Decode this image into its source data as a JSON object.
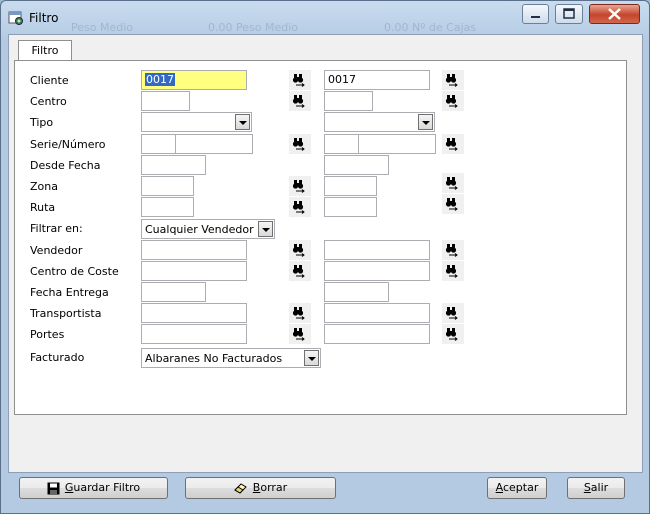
{
  "window": {
    "title": "Filtro",
    "background_hints": [
      "Peso Medio",
      "0.00 Peso Medio",
      "0.00 Nº de Cajas"
    ]
  },
  "tabs": [
    {
      "label": "Filtro",
      "active": true
    }
  ],
  "form": {
    "rows": {
      "cliente": {
        "label": "Cliente",
        "from": "0017",
        "to": "0017"
      },
      "centro": {
        "label": "Centro",
        "from": "",
        "to": ""
      },
      "tipo": {
        "label": "Tipo",
        "from": "",
        "to": ""
      },
      "serie_numero": {
        "label": "Serie/Número",
        "from_serie": "",
        "from_numero": "",
        "to_serie": "",
        "to_numero": ""
      },
      "desde_fecha": {
        "label": "Desde Fecha",
        "from": "",
        "to": ""
      },
      "zona": {
        "label": "Zona",
        "from": "",
        "to": ""
      },
      "ruta": {
        "label": "Ruta",
        "from": "",
        "to": ""
      },
      "filtrar_en": {
        "label": "Filtrar en:",
        "value": "Cualquier Vendedor"
      },
      "vendedor": {
        "label": "Vendedor",
        "from": "",
        "to": ""
      },
      "centro_coste": {
        "label": "Centro de Coste",
        "from": "",
        "to": ""
      },
      "fecha_entrega": {
        "label": "Fecha Entrega",
        "from": "",
        "to": ""
      },
      "transportista": {
        "label": "Transportista",
        "from": "",
        "to": ""
      },
      "portes": {
        "label": "Portes",
        "from": "",
        "to": ""
      },
      "facturado": {
        "label": "Facturado",
        "value": "Albaranes No Facturados"
      }
    }
  },
  "buttons": {
    "guardar_filtro": {
      "label_u": "G",
      "label_rest": "uardar Filtro"
    },
    "borrar": {
      "label_u": "B",
      "label_rest": "orrar"
    },
    "aceptar": {
      "label_u": "A",
      "label_rest": "ceptar"
    },
    "salir": {
      "label_u": "S",
      "label_rest": "alir"
    }
  },
  "colors": {
    "highlight_field": "#ffff80",
    "selection": "#3169c6"
  }
}
